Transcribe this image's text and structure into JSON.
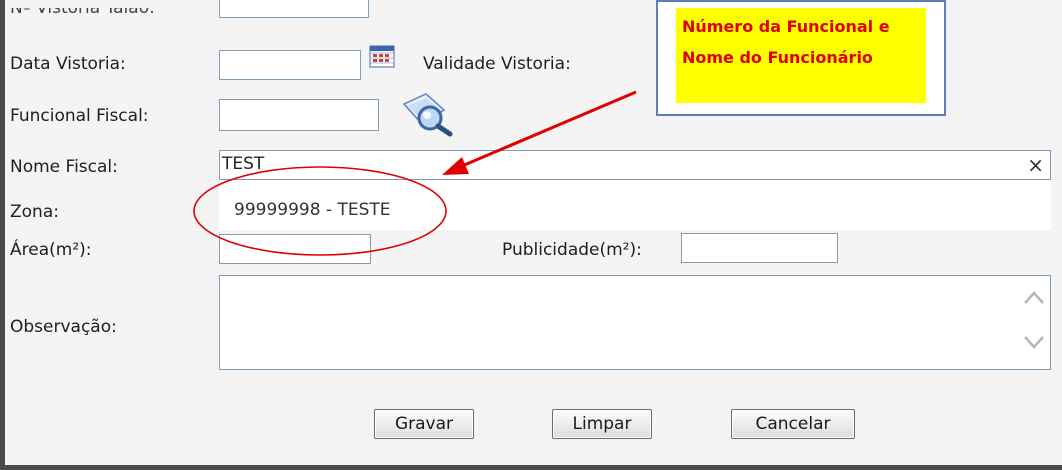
{
  "form": {
    "top_label": "Nº Vistoria Talao:",
    "data_vistoria_label": "Data Vistoria:",
    "data_vistoria_value": "",
    "validade_vistoria_label": "Validade Vistoria:",
    "funcional_fiscal_label": "Funcional Fiscal:",
    "funcional_fiscal_value": "",
    "nome_fiscal_label": "Nome Fiscal:",
    "nome_fiscal_value": "TEST",
    "clear_symbol": "×",
    "zona_label": "Zona:",
    "zona_suggestion": "99999998 - TESTE",
    "area_label": "Área(m²):",
    "area_value": "",
    "publicidade_label": "Publicidade(m²):",
    "publicidade_value": "",
    "observacao_label": "Observação:",
    "observacao_value": ""
  },
  "buttons": {
    "gravar": "Gravar",
    "limpar": "Limpar",
    "cancelar": "Cancelar"
  },
  "annotation": {
    "line1": "Número da Funcional e",
    "line2": "Nome do Funcionário",
    "text_color": "#e00000",
    "highlight_color": "#ffff00",
    "arrow_color": "#e00000"
  },
  "icons": {
    "calendar": "calendar-icon",
    "search": "magnifier-search-icon",
    "clear": "close-icon",
    "scroll_up": "chevron-up-icon",
    "scroll_down": "chevron-down-icon"
  }
}
